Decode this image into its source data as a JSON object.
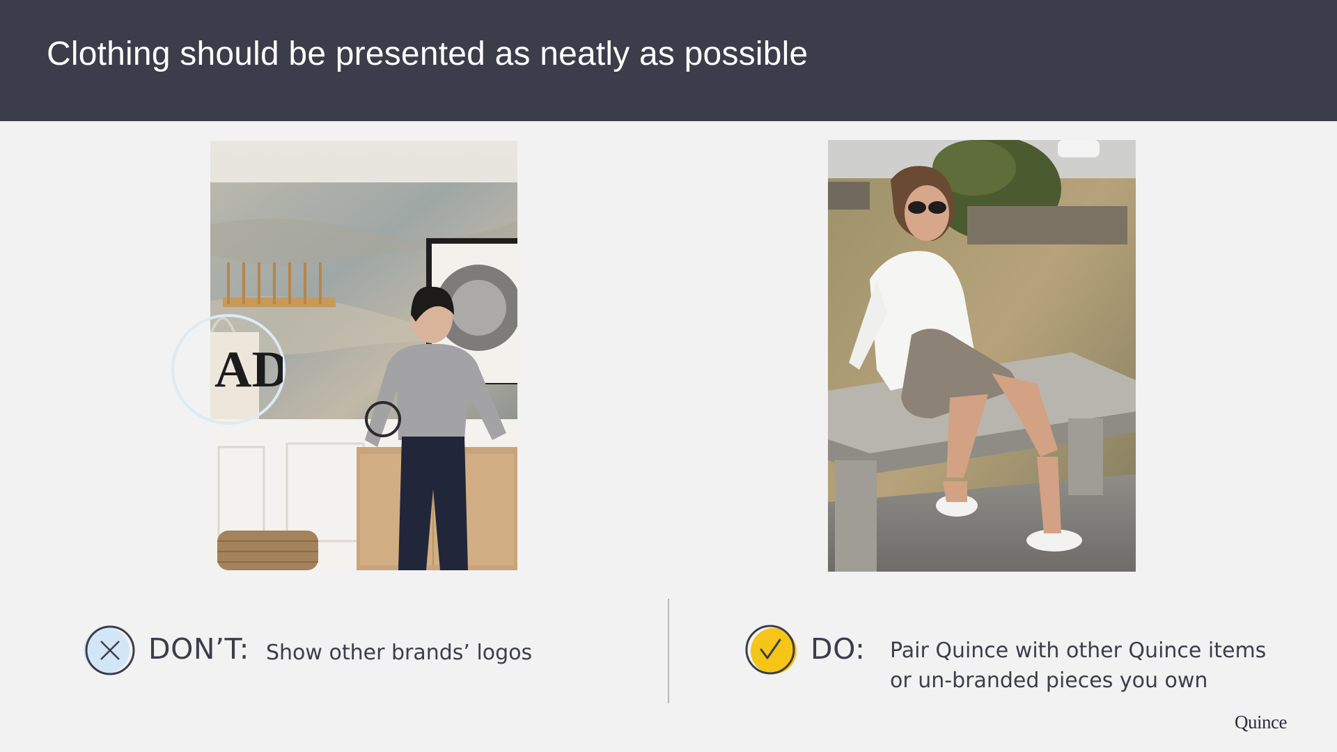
{
  "slide": {
    "title": "Clothing should be presented as neatly as possible",
    "brand": "Quince"
  },
  "colors": {
    "header_bg": "#3b3d4a",
    "slide_bg": "#f2f2f2",
    "text": "#3b3d4a",
    "do_accent": "#f5c518",
    "dont_accent": "#d3e6f7"
  },
  "dont": {
    "label": "DON’T:",
    "text": "Show other brands’ logos",
    "icon": "x-circle-icon"
  },
  "do": {
    "label": "DO:",
    "text_lines": [
      "Pair Quince with other Quince items",
      "or un-branded pieces you own"
    ],
    "icon": "check-circle-icon"
  },
  "photos": {
    "left": {
      "bag_logo": "AD"
    }
  }
}
